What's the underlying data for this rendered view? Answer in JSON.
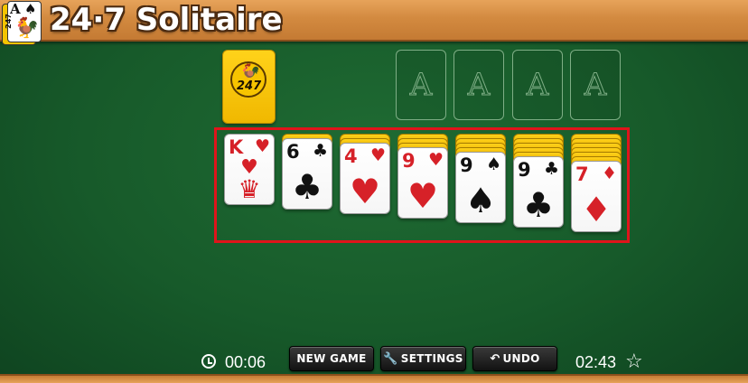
{
  "header": {
    "logo": {
      "rank": "A",
      "suit": "♠",
      "side_text": "247",
      "bird": "🐓"
    },
    "title": "24·7 Solitaire"
  },
  "stock": {
    "emblem_text": "247",
    "bird": "🐓"
  },
  "foundations": [
    {
      "label": "A"
    },
    {
      "label": "A"
    },
    {
      "label": "A"
    },
    {
      "label": "A"
    }
  ],
  "tableau": [
    {
      "face_down": 0,
      "card": {
        "rank": "K",
        "suit": "♥",
        "color": "red"
      }
    },
    {
      "face_down": 1,
      "card": {
        "rank": "6",
        "suit": "♣",
        "color": "black"
      }
    },
    {
      "face_down": 2,
      "card": {
        "rank": "4",
        "suit": "♥",
        "color": "red"
      }
    },
    {
      "face_down": 3,
      "card": {
        "rank": "9",
        "suit": "♥",
        "color": "red"
      }
    },
    {
      "face_down": 4,
      "card": {
        "rank": "9",
        "suit": "♠",
        "color": "black"
      }
    },
    {
      "face_down": 5,
      "card": {
        "rank": "9",
        "suit": "♣",
        "color": "black"
      }
    },
    {
      "face_down": 6,
      "card": {
        "rank": "7",
        "suit": "♦",
        "color": "red"
      }
    }
  ],
  "footer": {
    "elapsed_time": "00:06",
    "new_game_label": "NEW GAME",
    "settings_label": "SETTINGS",
    "undo_label": "UNDO",
    "best_time": "02:43",
    "star_icon": "☆",
    "settings_icon": "🔧",
    "undo_icon": "↶"
  },
  "colors": {
    "felt": "#175a2a",
    "wood": "#d38a40",
    "card_back": "#f7c400",
    "red_suit": "#d62128",
    "selection": "#e0141b"
  }
}
